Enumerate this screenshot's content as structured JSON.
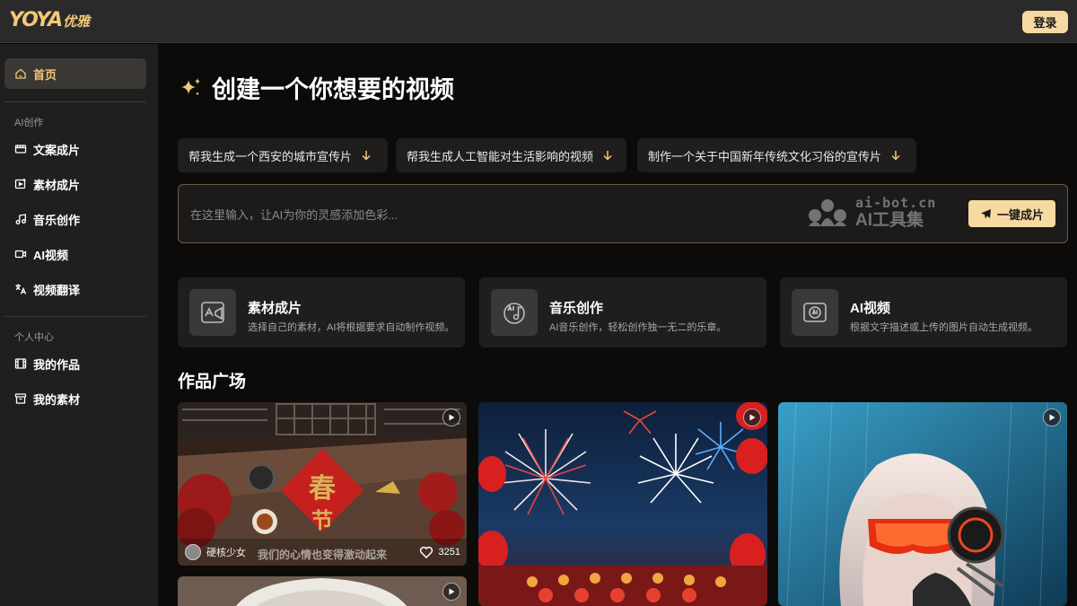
{
  "header": {
    "logo_text": "YOYA",
    "logo_cn": "优雅",
    "login_label": "登录"
  },
  "sidebar": {
    "home_label": "首页",
    "section_ai": "AI创作",
    "ai_items": [
      {
        "label": "文案成片",
        "icon": "script-film-icon"
      },
      {
        "label": "素材成片",
        "icon": "material-film-icon"
      },
      {
        "label": "音乐创作",
        "icon": "music-note-icon"
      },
      {
        "label": "AI视频",
        "icon": "video-camera-icon"
      },
      {
        "label": "视频翻译",
        "icon": "translate-icon"
      }
    ],
    "section_personal": "个人中心",
    "personal_items": [
      {
        "label": "我的作品",
        "icon": "film-strip-icon"
      },
      {
        "label": "我的素材",
        "icon": "archive-box-icon"
      }
    ]
  },
  "main": {
    "headline": "创建一个你想要的视频",
    "suggestions": [
      "帮我生成一个西安的城市宣传片",
      "帮我生成人工智能对生活影响的视频",
      "制作一个关于中国新年传统文化习俗的宣传片"
    ],
    "prompt_placeholder": "在这里输入，让AI为你的灵感添加色彩...",
    "watermark_url": "ai-bot.cn",
    "watermark_name": "AI工具集",
    "generate_label": "一键成片",
    "features": [
      {
        "title": "素材成片",
        "desc": "选择自己的素材，AI将根据要求自动制作视频。",
        "icon": "ai-material-icon"
      },
      {
        "title": "音乐创作",
        "desc": "AI音乐创作，轻松创作独一无二的乐章。",
        "icon": "ai-music-icon"
      },
      {
        "title": "AI视频",
        "desc": "根据文字描述或上传的图片自动生成视频。",
        "icon": "ai-video-icon"
      }
    ],
    "gallery_title": "作品广场",
    "gallery": [
      {
        "author": "硬核少女",
        "caption": "我们的心情也变得激动起来",
        "likes": "3251"
      },
      {
        "author": "",
        "caption": "",
        "likes": ""
      },
      {
        "author": "",
        "caption": "",
        "likes": ""
      }
    ]
  },
  "colors": {
    "accent": "#f7d9a2",
    "accent_text": "#f2c879",
    "background": "#0c0b0a",
    "sidebar": "#1f1f1f",
    "card": "#1f1e1d"
  }
}
